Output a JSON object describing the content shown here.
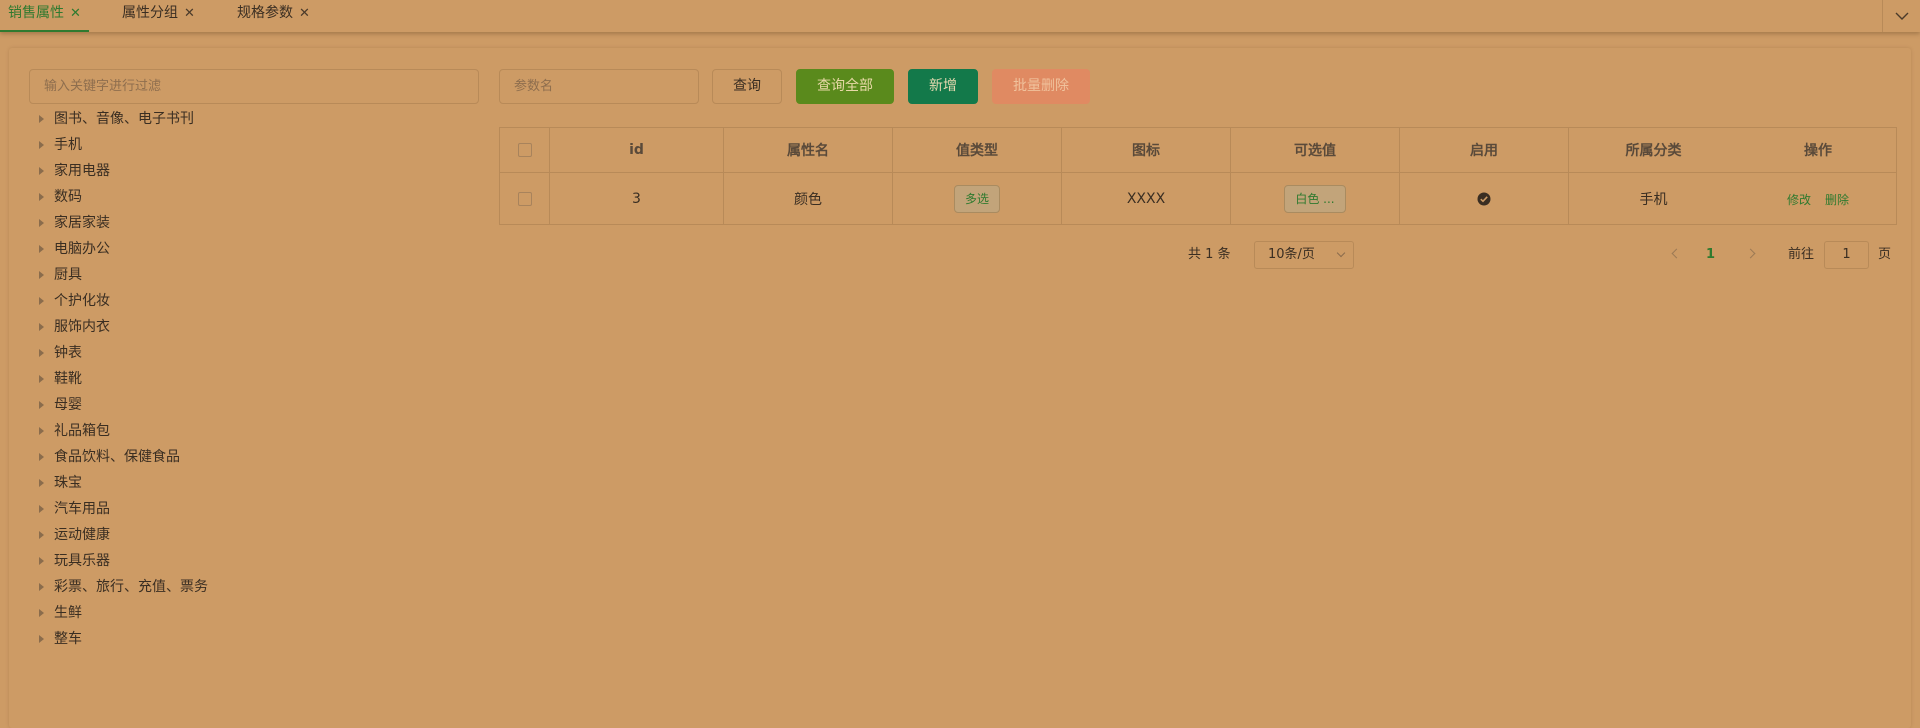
{
  "tabs": [
    {
      "label": "销售属性",
      "active": true
    },
    {
      "label": "属性分组",
      "active": false
    },
    {
      "label": "规格参数",
      "active": false
    }
  ],
  "tree": {
    "filter_placeholder": "输入关键字进行过滤",
    "nodes": [
      "图书、音像、电子书刊",
      "手机",
      "家用电器",
      "数码",
      "家居家装",
      "电脑办公",
      "厨具",
      "个护化妆",
      "服饰内衣",
      "钟表",
      "鞋靴",
      "母婴",
      "礼品箱包",
      "食品饮料、保健食品",
      "珠宝",
      "汽车用品",
      "运动健康",
      "玩具乐器",
      "彩票、旅行、充值、票务",
      "生鲜",
      "整车"
    ]
  },
  "toolbar": {
    "param_placeholder": "参数名",
    "query_label": "查询",
    "query_all_label": "查询全部",
    "add_label": "新增",
    "batch_delete_label": "批量删除"
  },
  "table": {
    "headers": [
      "id",
      "属性名",
      "值类型",
      "图标",
      "可选值",
      "启用",
      "所属分类",
      "操作"
    ],
    "rows": [
      {
        "id": "3",
        "name": "颜色",
        "value_type": "多选",
        "icon": "XXXX",
        "options": "白色 ...",
        "enabled": true,
        "category": "手机",
        "edit": "修改",
        "delete": "删除"
      }
    ]
  },
  "pagination": {
    "total": "共 1 条",
    "page_size": "10条/页",
    "current_page": "1",
    "goto_label": "前往",
    "goto_value": "1",
    "page_suffix": "页"
  },
  "colors": {
    "background": "#cd9b65",
    "accent": "#2f7a2f",
    "query_all_button": "#5a8a1c",
    "add_button": "#13794a",
    "batch_delete_button": "#e08a62"
  }
}
